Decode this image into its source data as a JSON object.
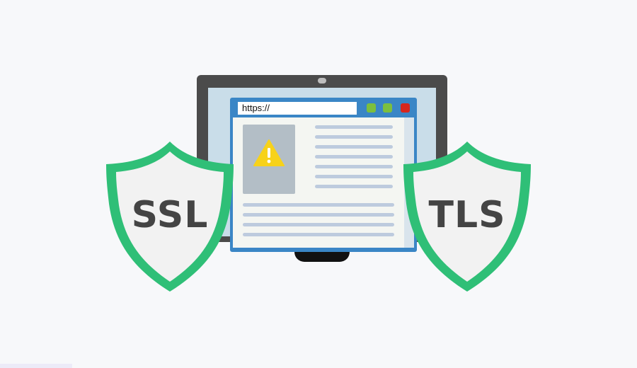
{
  "browser": {
    "address": "https://",
    "buttons": [
      {
        "name": "green-button-1",
        "color": "#7cbf3e"
      },
      {
        "name": "green-button-2",
        "color": "#7cbf3e"
      },
      {
        "name": "red-button",
        "color": "#d7261e"
      }
    ]
  },
  "illustration": {
    "warning_icon": "warning-triangle-icon",
    "shield_color": "#2fbf77",
    "shield_fill": "#f2f2f2"
  },
  "shields": [
    {
      "label": "SSL",
      "icon": "shield-icon"
    },
    {
      "label": "TLS",
      "icon": "shield-icon"
    }
  ]
}
